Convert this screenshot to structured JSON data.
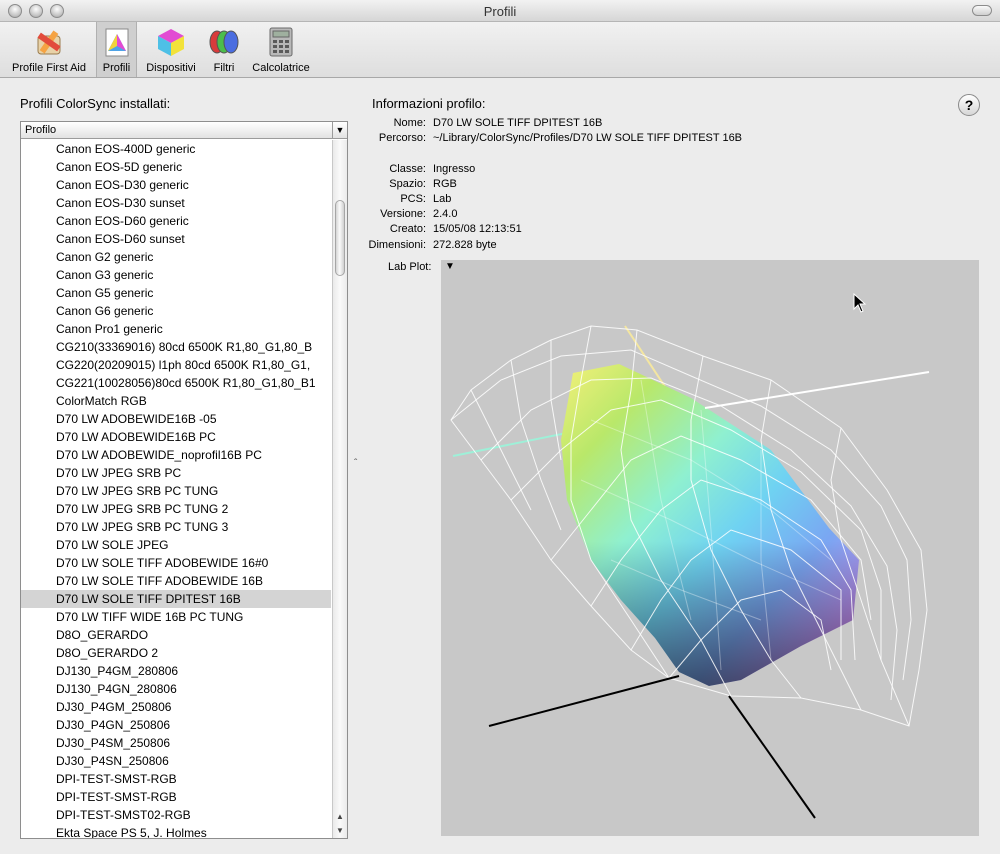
{
  "window": {
    "title": "Profili"
  },
  "toolbar": {
    "items": [
      {
        "label": "Profile First Aid",
        "icon": "first-aid-icon"
      },
      {
        "label": "Profili",
        "icon": "profiles-icon"
      },
      {
        "label": "Dispositivi",
        "icon": "devices-icon"
      },
      {
        "label": "Filtri",
        "icon": "filters-icon"
      },
      {
        "label": "Calcolatrice",
        "icon": "calculator-icon"
      }
    ]
  },
  "sidebar": {
    "title": "Profili ColorSync installati:",
    "column_header": "Profilo",
    "selected": "D70 LW SOLE TIFF DPITEST 16B",
    "items": [
      "Canon EOS-400D generic",
      "Canon EOS-5D generic",
      "Canon EOS-D30 generic",
      "Canon EOS-D30 sunset",
      "Canon EOS-D60 generic",
      "Canon EOS-D60 sunset",
      "Canon G2 generic",
      "Canon G3 generic",
      "Canon G5 generic",
      "Canon G6 generic",
      "Canon Pro1 generic",
      "CG210(33369016) 80cd 6500K R1,80_G1,80_B",
      "CG220(20209015) l1ph 80cd 6500K R1,80_G1,",
      "CG221(10028056)80cd 6500K R1,80_G1,80_B1",
      "ColorMatch RGB",
      "D70 LW ADOBEWIDE16B -05",
      "D70 LW ADOBEWIDE16B PC",
      "D70 LW ADOBEWIDE_noprofil16B PC",
      "D70 LW JPEG SRB PC",
      "D70 LW JPEG SRB PC TUNG",
      "D70 LW JPEG SRB PC TUNG 2",
      "D70 LW JPEG SRB PC TUNG 3",
      "D70 LW SOLE JPEG",
      "D70 LW SOLE TIFF ADOBEWIDE 16#0",
      "D70 LW SOLE TIFF ADOBEWIDE 16B",
      "D70 LW SOLE TIFF DPITEST 16B",
      "D70 LW TIFF WIDE 16B PC TUNG",
      "D8O_GERARDO",
      "D8O_GERARDO 2",
      "DJ130_P4GM_280806",
      "DJ130_P4GN_280806",
      "DJ30_P4GM_250806",
      "DJ30_P4GN_250806",
      "DJ30_P4SM_250806",
      "DJ30_P4SN_250806",
      "DPI-TEST-SMST-RGB",
      "DPI-TEST-SMST-RGB",
      "DPI-TEST-SMST02-RGB",
      "Ekta Space PS 5, J. Holmes"
    ]
  },
  "info": {
    "title": "Informazioni profilo:",
    "rows_top": [
      {
        "key": "Nome:",
        "value": "D70 LW SOLE TIFF DPITEST 16B"
      },
      {
        "key": "Percorso:",
        "value": "~/Library/ColorSync/Profiles/D70 LW SOLE TIFF DPITEST 16B"
      }
    ],
    "rows": [
      {
        "key": "Classe:",
        "value": "Ingresso"
      },
      {
        "key": "Spazio:",
        "value": "RGB"
      },
      {
        "key": "PCS:",
        "value": "Lab"
      },
      {
        "key": "Versione:",
        "value": "2.4.0"
      },
      {
        "key": "Creato:",
        "value": "15/05/08 12:13:51"
      },
      {
        "key": "Dimensioni:",
        "value": "272.828 byte"
      }
    ],
    "lab_plot_label": "Lab Plot:",
    "help": "?"
  }
}
